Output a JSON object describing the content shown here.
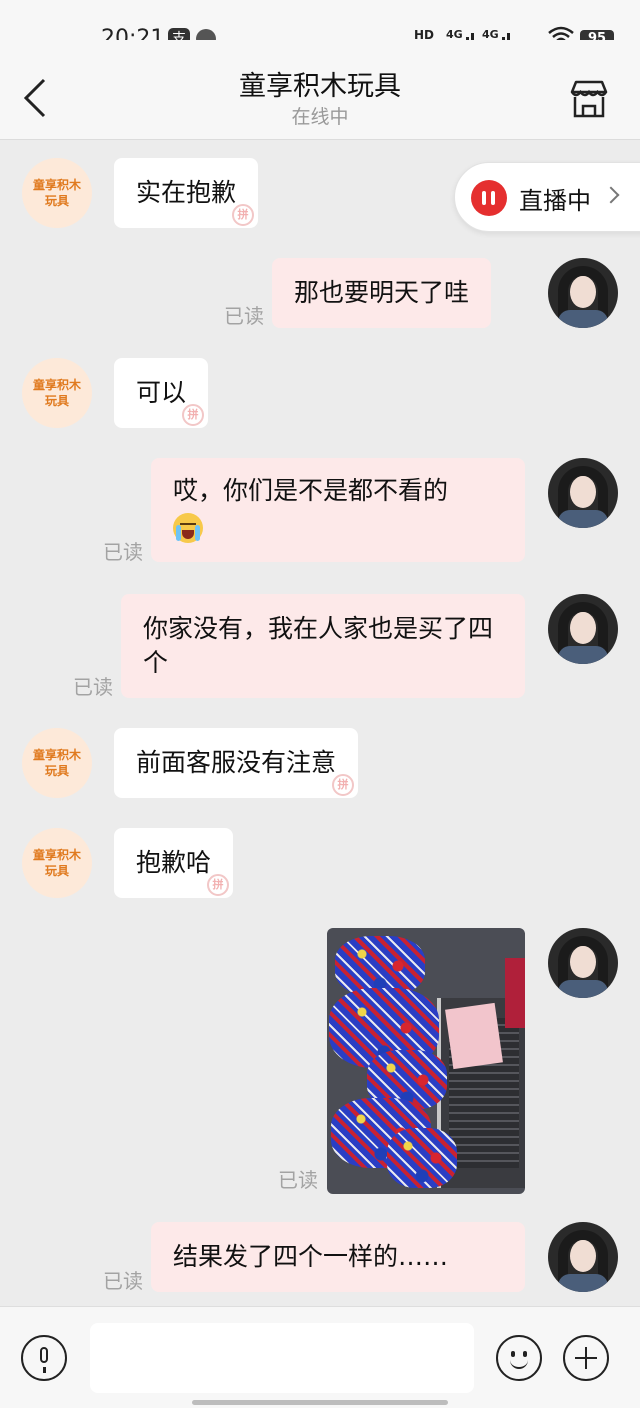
{
  "status_bar": {
    "time": "20:21",
    "hd_label": "HD",
    "sim1": "4G",
    "sim2": "4G",
    "battery": "95"
  },
  "header": {
    "title": "童享积木玩具",
    "subtitle": "在线中",
    "back_icon": "chevron-left-icon",
    "shop_icon": "storefront-icon"
  },
  "live_badge": {
    "label": "直播中"
  },
  "shop_avatar": {
    "line1": "童享积木",
    "line2": "玩具"
  },
  "read_label": "已读",
  "messages": [
    {
      "from": "shop",
      "text": "实在抱歉"
    },
    {
      "from": "me",
      "text": "那也要明天了哇",
      "status": "已读"
    },
    {
      "from": "shop",
      "text": "可以"
    },
    {
      "from": "me",
      "text": "哎，你们是不是都不看的",
      "emoji": "crying-face",
      "status": "已读"
    },
    {
      "from": "me",
      "text": "你家没有，我在人家也是买了四个",
      "status": "已读"
    },
    {
      "from": "shop",
      "text": "前面客服没有注意"
    },
    {
      "from": "shop",
      "text": "抱歉哈"
    },
    {
      "from": "me",
      "type": "image",
      "status": "已读"
    },
    {
      "from": "me",
      "text": "结果发了四个一样的……",
      "status": "已读"
    }
  ],
  "input_bar": {
    "voice_icon": "microphone-icon",
    "emoji_icon": "smiley-icon",
    "more_icon": "plus-icon",
    "placeholder": ""
  },
  "colors": {
    "background": "#ececec",
    "my_bubble": "#fde9e9",
    "shop_bubble": "#ffffff",
    "shop_avatar_bg": "#fde9d9",
    "shop_avatar_text": "#e07a1f",
    "live_red": "#e52f2f"
  }
}
